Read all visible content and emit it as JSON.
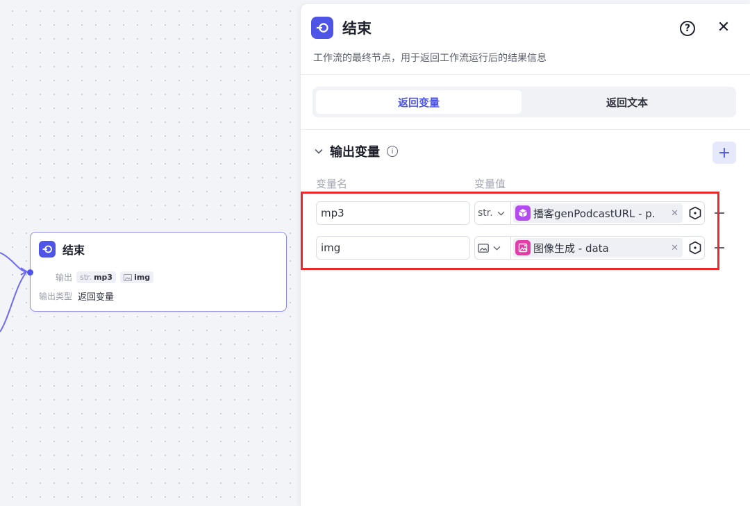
{
  "canvas": {
    "node": {
      "title": "结束",
      "output_label": "输出",
      "outputs": [
        {
          "prefix": "str.",
          "name": "mp3"
        },
        {
          "prefix": "",
          "name": "img"
        }
      ],
      "output_type_label": "输出类型",
      "output_type_value": "返回变量"
    }
  },
  "panel": {
    "title": "结束",
    "description": "工作流的最终节点，用于返回工作流运行后的结果信息",
    "help_icon": "?",
    "close_icon": "✕",
    "tabs": [
      {
        "label": "返回变量",
        "active": true
      },
      {
        "label": "返回文本",
        "active": false
      }
    ],
    "section": {
      "title": "输出变量",
      "add_icon": "+",
      "col_name": "变量名",
      "col_value": "变量值",
      "rows": [
        {
          "name": "mp3",
          "type": "str.",
          "ref": "播客genPodcastURL - p..",
          "ref_icon_color": "#b44bf0"
        },
        {
          "name": "img",
          "type": "image",
          "ref": "图像生成 - data",
          "ref_icon_color": "#e33ea8"
        }
      ]
    }
  },
  "colors": {
    "accent": "#4e55e6",
    "highlight": "#e8272b"
  }
}
